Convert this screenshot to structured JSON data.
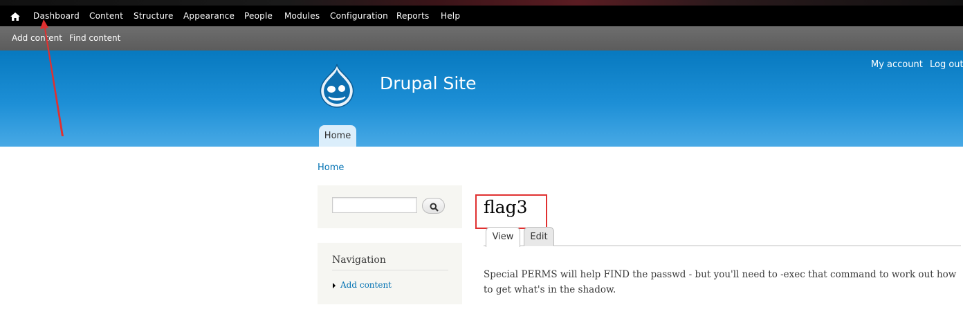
{
  "toolbar": {
    "items": [
      "Dashboard",
      "Content",
      "Structure",
      "Appearance",
      "People",
      "Modules",
      "Configuration",
      "Reports",
      "Help"
    ]
  },
  "shortcuts": {
    "items": [
      "Add content",
      "Find content"
    ]
  },
  "header": {
    "site_name": "Drupal Site",
    "secondary_menu": [
      "My account",
      "Log out"
    ],
    "main_menu": [
      "Home"
    ]
  },
  "breadcrumb": "Home",
  "sidebar": {
    "search": {
      "value": "",
      "placeholder": "",
      "button_icon": "search-icon"
    },
    "navigation": {
      "title": "Navigation",
      "links": [
        "Add content"
      ]
    }
  },
  "main": {
    "title": "flag3",
    "tabs": [
      "View",
      "Edit"
    ],
    "body": "Special PERMS will help FIND the passwd - but you'll need to -exec that command to work out how to get what's in the shadow."
  },
  "annotations": {
    "color": "#e03030"
  }
}
